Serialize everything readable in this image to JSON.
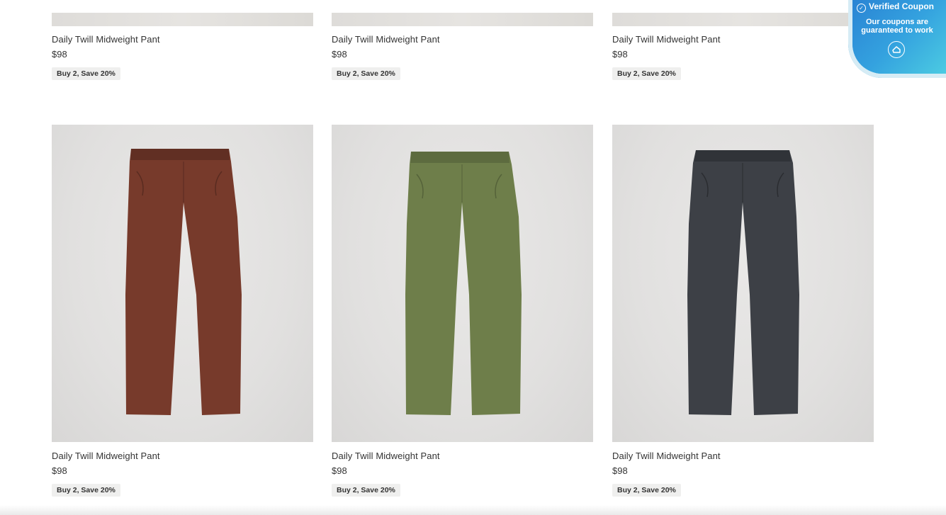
{
  "products": [
    {
      "name": "Daily Twill Midweight Pant",
      "price": "$98",
      "promo": "Buy 2, Save 20%",
      "color": "#7a3a2c"
    },
    {
      "name": "Daily Twill Midweight Pant",
      "price": "$98",
      "promo": "Buy 2, Save 20%",
      "color": "#6b7b4a"
    },
    {
      "name": "Daily Twill Midweight Pant",
      "price": "$98",
      "promo": "Buy 2, Save 20%",
      "color": "#d6d3cc"
    },
    {
      "name": "Daily Twill Midweight Pant",
      "price": "$98",
      "promo": "Buy 2, Save 20%",
      "color": "#773a2b"
    },
    {
      "name": "Daily Twill Midweight Pant",
      "price": "$98",
      "promo": "Buy 2, Save 20%",
      "color": "#6e7e4a"
    },
    {
      "name": "Daily Twill Midweight Pant",
      "price": "$98",
      "promo": "Buy 2, Save 20%",
      "color": "#3d4046"
    }
  ],
  "coupon_badge": {
    "title": "Verified Coupon",
    "subtitle": "Our coupons are guaranteed to work",
    "icon": "check-circle-icon",
    "logo_icon": "coupon-logo-icon",
    "accent": "#36a3df"
  }
}
